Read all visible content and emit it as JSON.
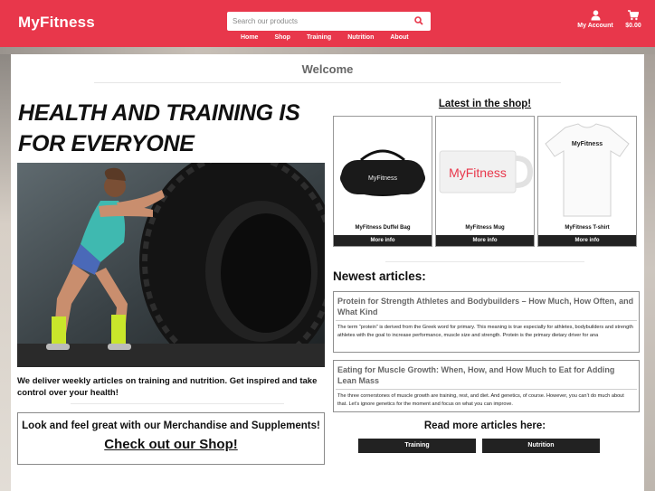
{
  "brand": {
    "name": "MyFitness",
    "accent": "#e8374b"
  },
  "search": {
    "placeholder": "Search our products",
    "icon": "search-icon"
  },
  "nav": {
    "items": [
      "Home",
      "Shop",
      "Training",
      "Nutrition",
      "About"
    ]
  },
  "account": {
    "label": "My Account",
    "icon": "user-icon"
  },
  "cart": {
    "label": "$0.00",
    "icon": "cart-icon"
  },
  "main": {
    "welcome": "Welcome",
    "hero_title": "HEALTH AND TRAINING IS FOR EVERYONE",
    "tagline": "We deliver weekly articles on training and nutrition. Get inspired and take control over your health!",
    "merch": {
      "text": "Look and feel great with our Merchandise and Supplements!",
      "link": "Check out our Shop!"
    }
  },
  "shop": {
    "title": "Latest in the shop!",
    "products": [
      {
        "name": "MyFitness Duffel Bag",
        "button": "More info",
        "print": "MyFitness"
      },
      {
        "name": "MyFitness Mug",
        "button": "More info",
        "print": "MyFitness"
      },
      {
        "name": "MyFitness T-shirt",
        "button": "More info",
        "print": "MyFitness"
      }
    ]
  },
  "articles": {
    "heading": "Newest articles:",
    "items": [
      {
        "title": "Protein for Strength Athletes and Bodybuilders – How Much, How Often, and What Kind",
        "excerpt": "The term “protein” is derived from the Greek word for primary. This meaning is true especially for athletes, bodybuilders and strength athletes with the goal to increase performance, muscle size and strength. Protein is the primary dietary driver for ana"
      },
      {
        "title": "Eating for Muscle Growth: When, How, and How Much to Eat for Adding Lean Mass",
        "excerpt": "The three cornerstones of muscle growth are training, rest, and diet. And genetics, of course. However, you can’t do much about that. Let’s ignore genetics for the moment and focus on what you can improve."
      }
    ],
    "read_more": "Read more articles here:",
    "buttons": [
      "Training",
      "Nutrition"
    ]
  }
}
